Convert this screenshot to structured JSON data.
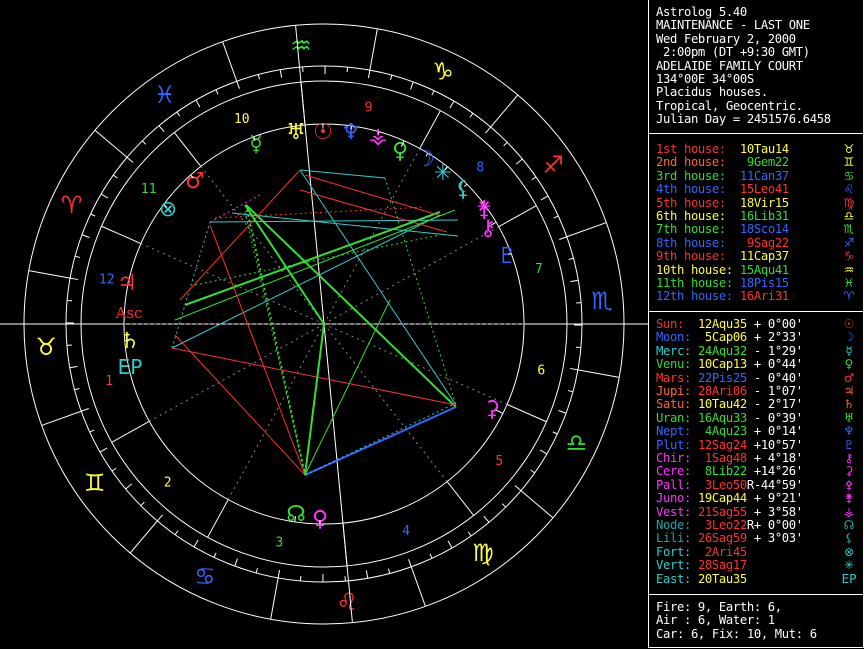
{
  "colors": {
    "white": "#ffffff",
    "red": "#ff3030",
    "green": "#33dd33",
    "blue": "#3366ff",
    "yellow": "#ffff33",
    "cyan": "#33cccc",
    "magenta": "#ff33ff",
    "orange": "#ff6633",
    "dkcyan": "#21a6a6"
  },
  "header": [
    "Astrolog 5.40",
    "MAINTENANCE - LAST ONE",
    "Wed February 2, 2000",
    " 2:00pm (DT +9:30 GMT)",
    "ADELAIDE FAMILY COURT",
    "134°00E 34°00S",
    "Placidus houses.",
    "Tropical, Geocentric.",
    "Julian Day = 2451576.6458"
  ],
  "houses": [
    {
      "name": "1st house:",
      "value": "10Tau14",
      "color": "red",
      "glyph": "♉",
      "vcolor": "yellow",
      "gcolor": "yellow"
    },
    {
      "name": "2nd house:",
      "value": " 9Gem22",
      "color": "orange",
      "glyph": "♊",
      "vcolor": "green",
      "gcolor": "yellow"
    },
    {
      "name": "3rd house:",
      "value": "11Can37",
      "color": "green",
      "glyph": "♋",
      "vcolor": "blue",
      "gcolor": "green"
    },
    {
      "name": "4th house:",
      "value": "15Leo41",
      "color": "blue",
      "glyph": "♌",
      "vcolor": "red",
      "gcolor": "blue"
    },
    {
      "name": "5th house:",
      "value": "18Vir15",
      "color": "red",
      "glyph": "♍",
      "vcolor": "yellow",
      "gcolor": "red"
    },
    {
      "name": "6th house:",
      "value": "16Lib31",
      "color": "yellow",
      "glyph": "♎",
      "vcolor": "green",
      "gcolor": "yellow"
    },
    {
      "name": "7th house:",
      "value": "18Sco14",
      "color": "green",
      "glyph": "♏",
      "vcolor": "blue",
      "gcolor": "green"
    },
    {
      "name": "8th house:",
      "value": " 9Sag22",
      "color": "blue",
      "glyph": "♐",
      "vcolor": "red",
      "gcolor": "blue"
    },
    {
      "name": "9th house:",
      "value": "11Cap37",
      "color": "red",
      "glyph": "♑",
      "vcolor": "yellow",
      "gcolor": "red"
    },
    {
      "name": "10th house:",
      "value": "15Aqu41",
      "color": "yellow",
      "glyph": "♒",
      "vcolor": "green",
      "gcolor": "yellow"
    },
    {
      "name": "11th house:",
      "value": "18Pis15",
      "color": "green",
      "glyph": "♓",
      "vcolor": "blue",
      "gcolor": "green"
    },
    {
      "name": "12th house:",
      "value": "16Ari31",
      "color": "blue",
      "glyph": "♈",
      "vcolor": "red",
      "gcolor": "blue"
    }
  ],
  "planets": [
    {
      "name": "Sun:",
      "pos": "12Aqu35",
      "retro": " ",
      "lat": "+ 0°00'",
      "glyph": "☉",
      "color": "red",
      "pcolor": "yellow"
    },
    {
      "name": "Moon:",
      "pos": " 5Cap06",
      "retro": " ",
      "lat": "+ 2°33'",
      "glyph": "☽",
      "color": "blue",
      "pcolor": "yellow"
    },
    {
      "name": "Merc:",
      "pos": "24Aqu32",
      "retro": " ",
      "lat": "- 1°29'",
      "glyph": "☿",
      "color": "cyan",
      "pcolor": "green"
    },
    {
      "name": "Venu:",
      "pos": "10Cap13",
      "retro": " ",
      "lat": "+ 0°44'",
      "glyph": "♀",
      "color": "green",
      "pcolor": "yellow"
    },
    {
      "name": "Mars:",
      "pos": "22Pis25",
      "retro": " ",
      "lat": "- 0°40'",
      "glyph": "♂",
      "color": "red",
      "pcolor": "blue"
    },
    {
      "name": "Jupi:",
      "pos": "28Ari06",
      "retro": " ",
      "lat": "- 1°07'",
      "glyph": "♃",
      "color": "orange",
      "pcolor": "red"
    },
    {
      "name": "Satu:",
      "pos": "10Tau42",
      "retro": " ",
      "lat": "- 2°17'",
      "glyph": "♄",
      "color": "orange",
      "pcolor": "yellow"
    },
    {
      "name": "Uran:",
      "pos": "16Aqu33",
      "retro": " ",
      "lat": "- 0°39'",
      "glyph": "♅",
      "color": "green",
      "pcolor": "green"
    },
    {
      "name": "Nept:",
      "pos": " 4Aqu23",
      "retro": " ",
      "lat": "+ 0°14'",
      "glyph": "♆",
      "color": "blue",
      "pcolor": "green"
    },
    {
      "name": "Plut:",
      "pos": "12Sag24",
      "retro": " ",
      "lat": "+10°57'",
      "glyph": "♇",
      "color": "blue",
      "pcolor": "red"
    },
    {
      "name": "Chir:",
      "pos": " 1Sag48",
      "retro": " ",
      "lat": "+ 4°18'",
      "glyph": "⚷",
      "color": "magenta",
      "pcolor": "red"
    },
    {
      "name": "Cere:",
      "pos": " 8Lib22",
      "retro": " ",
      "lat": "+14°26'",
      "glyph": "⚳",
      "color": "magenta",
      "pcolor": "green"
    },
    {
      "name": "Pall:",
      "pos": " 3Leo50",
      "retro": "R",
      "lat": "-44°59'",
      "glyph": "⚴",
      "color": "magenta",
      "pcolor": "red"
    },
    {
      "name": "Juno:",
      "pos": "19Cap44",
      "retro": " ",
      "lat": "+ 9°21'",
      "glyph": "⚵",
      "color": "magenta",
      "pcolor": "yellow"
    },
    {
      "name": "Vest:",
      "pos": "21Sag55",
      "retro": " ",
      "lat": "+ 3°58'",
      "glyph": "⚶",
      "color": "magenta",
      "pcolor": "red"
    },
    {
      "name": "Node:",
      "pos": " 3Leo22",
      "retro": "R",
      "lat": "+ 0°00'",
      "glyph": "☊",
      "color": "dkcyan",
      "pcolor": "red"
    },
    {
      "name": "Lili:",
      "pos": "26Sag59",
      "retro": " ",
      "lat": "+ 3°03'",
      "glyph": "⚸",
      "color": "dkcyan",
      "pcolor": "red"
    },
    {
      "name": "Fort:",
      "pos": " 2Ari45",
      "retro": "",
      "lat": "",
      "glyph": "⊗",
      "color": "cyan",
      "pcolor": "red"
    },
    {
      "name": "Vert:",
      "pos": "28Sag17",
      "retro": "",
      "lat": "",
      "glyph": "✳",
      "color": "cyan",
      "pcolor": "red"
    },
    {
      "name": "East:",
      "pos": "20Tau35",
      "retro": "",
      "lat": "",
      "glyph": "EP",
      "color": "cyan",
      "pcolor": "yellow"
    }
  ],
  "elements": [
    "Fire: 9, Earth: 6,",
    "Air : 6, Water: 1",
    "Car: 6, Fix: 10, Mut: 6"
  ],
  "wheel": {
    "signs": [
      {
        "glyph": "♉",
        "color": "yellow"
      },
      {
        "glyph": "♈",
        "color": "red"
      },
      {
        "glyph": "♓",
        "color": "blue"
      },
      {
        "glyph": "♒",
        "color": "green"
      },
      {
        "glyph": "♑",
        "color": "yellow"
      },
      {
        "glyph": "♐",
        "color": "red"
      },
      {
        "glyph": "♏",
        "color": "blue"
      },
      {
        "glyph": "♎",
        "color": "green"
      },
      {
        "glyph": "♍",
        "color": "yellow"
      },
      {
        "glyph": "♌",
        "color": "red"
      },
      {
        "glyph": "♋",
        "color": "blue"
      },
      {
        "glyph": "♊",
        "color": "yellow"
      }
    ],
    "house_numbers": [
      {
        "num": "1",
        "color": "red"
      },
      {
        "num": "2",
        "color": "yellow"
      },
      {
        "num": "3",
        "color": "green"
      },
      {
        "num": "4",
        "color": "blue"
      },
      {
        "num": "5",
        "color": "red"
      },
      {
        "num": "6",
        "color": "yellow"
      },
      {
        "num": "7",
        "color": "green"
      },
      {
        "num": "8",
        "color": "blue"
      },
      {
        "num": "9",
        "color": "red"
      },
      {
        "num": "10",
        "color": "yellow"
      },
      {
        "num": "11",
        "color": "green"
      },
      {
        "num": "12",
        "color": "blue"
      }
    ],
    "asc_label": "Asc",
    "chart_planets": [
      {
        "glyph": "☿",
        "color": "green"
      },
      {
        "glyph": "♅",
        "color": "yellow"
      },
      {
        "glyph": "☉",
        "color": "red"
      },
      {
        "glyph": "♆",
        "color": "blue"
      },
      {
        "glyph": "⚶",
        "color": "magenta"
      },
      {
        "glyph": "♀",
        "color": "green"
      },
      {
        "glyph": "☽",
        "color": "blue"
      },
      {
        "glyph": "✳",
        "color": "cyan"
      },
      {
        "glyph": "⚸",
        "color": "cyan"
      },
      {
        "glyph": "⚵",
        "color": "magenta"
      },
      {
        "glyph": "⚷",
        "color": "magenta"
      },
      {
        "glyph": "♇",
        "color": "blue"
      },
      {
        "glyph": "⚳",
        "color": "magenta"
      },
      {
        "glyph": "☊",
        "color": "green"
      },
      {
        "glyph": "♀",
        "color": "magenta"
      },
      {
        "glyph": "♂",
        "color": "red"
      },
      {
        "glyph": "⊗",
        "color": "cyan"
      },
      {
        "glyph": "♃",
        "color": "red"
      },
      {
        "glyph": "♄",
        "color": "yellow"
      },
      {
        "glyph": "EP",
        "color": "cyan"
      }
    ]
  }
}
